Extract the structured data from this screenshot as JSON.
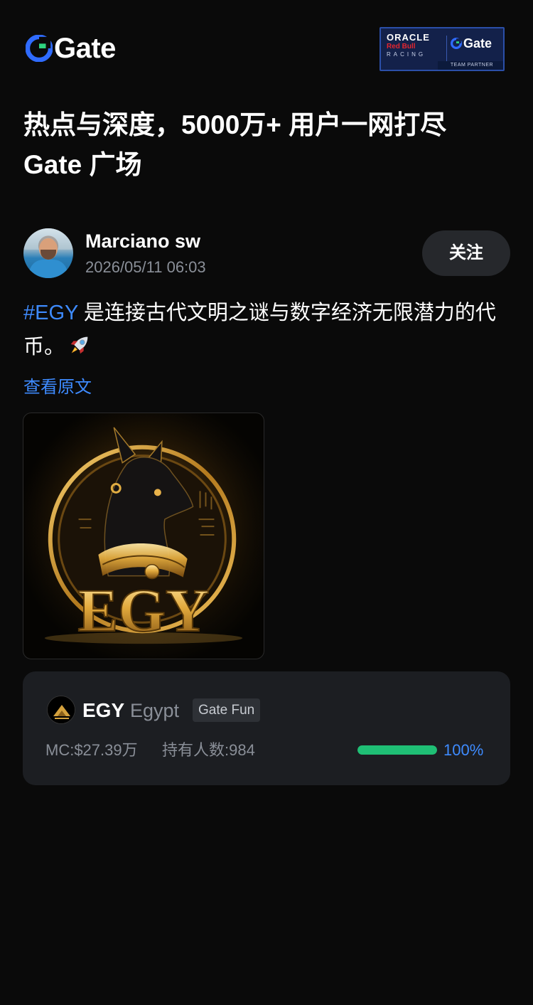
{
  "header": {
    "logo_text": "Gate",
    "partner": {
      "oracle": "ORACLE",
      "redbull": "Red Bull",
      "racing": "RACING",
      "gate": "Gate",
      "team_partner": "TEAM PARTNER"
    }
  },
  "headline": {
    "line1": "热点与深度，5000万+ 用户一网打尽",
    "line2": "Gate 广场"
  },
  "post": {
    "author": "Marciano sw",
    "time": "2026/05/11 06:03",
    "follow_label": "关注",
    "hashtag": "#EGY",
    "text": " 是连接古代文明之谜与数字经济无限潜力的代币。",
    "emoji_icon": "rocket-icon",
    "view_original": "查看原文",
    "image_text": "EGY"
  },
  "token": {
    "symbol": "EGY",
    "name": "Egypt",
    "tag": "Gate Fun",
    "market_cap": "MC:$27.39万",
    "holders": "持有人数:984",
    "progress": 1.0,
    "progress_label": "100%"
  },
  "colors": {
    "background": "#0a0a0a",
    "accent": "#3e8bff",
    "progress": "#1fbf75",
    "card": "#1c1e22"
  }
}
